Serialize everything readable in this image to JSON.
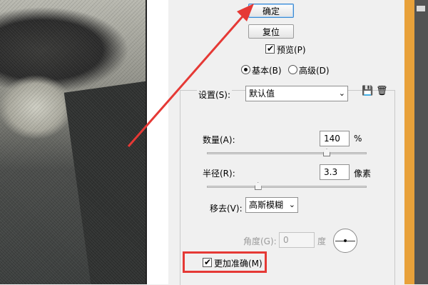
{
  "dialog": {
    "ok_label": "确定",
    "reset_label": "复位",
    "preview_label": "预览(P)",
    "mode_basic": "基本(B)",
    "mode_advanced": "高级(D)",
    "settings_label": "设置(S):",
    "settings_value": "默认值",
    "amount_label": "数量(A):",
    "amount_value": "140",
    "amount_unit": "%",
    "amount_level": 0.75,
    "radius_label": "半径(R):",
    "radius_value": "3.3",
    "radius_unit": "像素",
    "radius_level": 0.32,
    "remove_label": "移去(V):",
    "remove_value": "高斯模糊",
    "angle_label": "角度(G):",
    "angle_value": "0",
    "angle_unit": "度",
    "more_accurate_label": "更加准确(M)"
  },
  "colors": {
    "annotation": "#e53935",
    "dialog_bg": "#f0f0f0"
  }
}
